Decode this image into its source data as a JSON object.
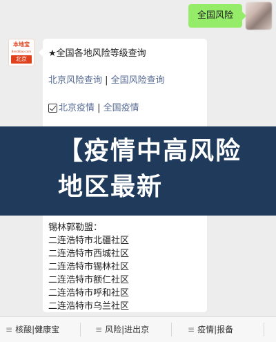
{
  "chat": {
    "user_message": "全国风险",
    "card": {
      "title": "★全国各地风险等级查询",
      "risk_link_beijing": "北京风险查询",
      "risk_link_national": "全国风险查询",
      "separator": " | ",
      "epidemic_link_beijing": "北京疫情",
      "epidemic_link_national": "全国疫情",
      "region_heading": "锡林郭勒盟：",
      "communities": [
        "二连浩特市北疆社区",
        "二连浩特市西城社区",
        "二连浩特市锡林社区",
        "二连浩特市额仁社区",
        "二连浩特市呼和社区",
        "二连浩特市乌兰社区"
      ]
    },
    "bot_avatar": {
      "brand": "本地宝",
      "brand_sub": "Bendibao.com",
      "city": "北京"
    }
  },
  "banner": {
    "text": "【疫情中高风险地区最新"
  },
  "bottom_menu": {
    "items": [
      "核酸|健康宝",
      "风险|进出京",
      "疫情|报备"
    ],
    "menu_icon": "hamburger-icon"
  },
  "colors": {
    "user_bubble": "#95ec69",
    "link": "#576b95",
    "banner_bg": "#1f3a5b",
    "brand_red": "#e0401b"
  }
}
